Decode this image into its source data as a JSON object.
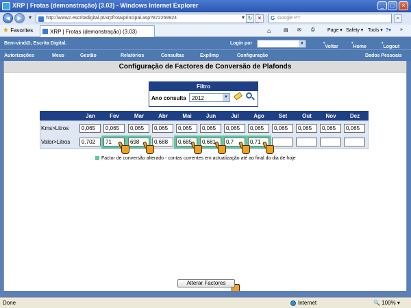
{
  "window": {
    "title": "XRP | Frotas (demonstração) (3.03) - Windows Internet Explorer"
  },
  "browser": {
    "address": "http://www2.escritadigital.pt/xrpfrota/principal.asp?872269924",
    "search_placeholder": "Google PT",
    "search_engine_letter": "G",
    "favorites_label": "Favorites",
    "tab_title": "XRP | Frotas (demonstração) (3.03)",
    "commands": [
      "Page ▾",
      "Safety ▾",
      "Tools ▾"
    ],
    "status_text": "Done",
    "zone": "Internet",
    "zoom": "100%"
  },
  "app": {
    "welcome": "Bem-vind@, Escrita Digital.",
    "login_label": "Login por",
    "voltar": "Voltar",
    "home": "Home",
    "logout": "Logout",
    "menu": [
      "Autorizações",
      "Meus",
      "Gestão",
      "Relatórios",
      "Consultas",
      "Exp/Imp",
      "Configuração",
      "Dados Pessoais"
    ]
  },
  "page": {
    "title": "Configuração de Factores de Conversão de Plafonds",
    "filter": {
      "header": "Filtro",
      "label": "Ano consulta",
      "year": "2012"
    },
    "months": [
      "Jan",
      "Fev",
      "Mar",
      "Abr",
      "Mai",
      "Jun",
      "Jul",
      "Ago",
      "Set",
      "Out",
      "Nov",
      "Dez"
    ],
    "rows": [
      {
        "label": "Kms>Litros",
        "values": [
          "0,065",
          "0,065",
          "0,065",
          "0,065",
          "0,065",
          "0,065",
          "0,065",
          "0,065",
          "0,065",
          "0,065",
          "0,065",
          "0,065"
        ]
      },
      {
        "label": "Valor>Litros",
        "values": [
          "0,702",
          "71",
          "698",
          "0,688",
          "0,685",
          "0,681",
          "0,7",
          "0,71",
          "",
          "",
          "",
          ""
        ]
      }
    ],
    "changed_cells": [
      1,
      2,
      4,
      5,
      6,
      7
    ],
    "legend": "Factor de conversão alterado - contas correntes em actualização até ao final do dia de hoje",
    "submit_label": "Alterar Factores"
  },
  "colors": {
    "header_blue": "#4e79b1",
    "table_header": "#1f3f86",
    "changed_highlight": "#62c7a0",
    "cursor_orange": "#f2a024"
  }
}
